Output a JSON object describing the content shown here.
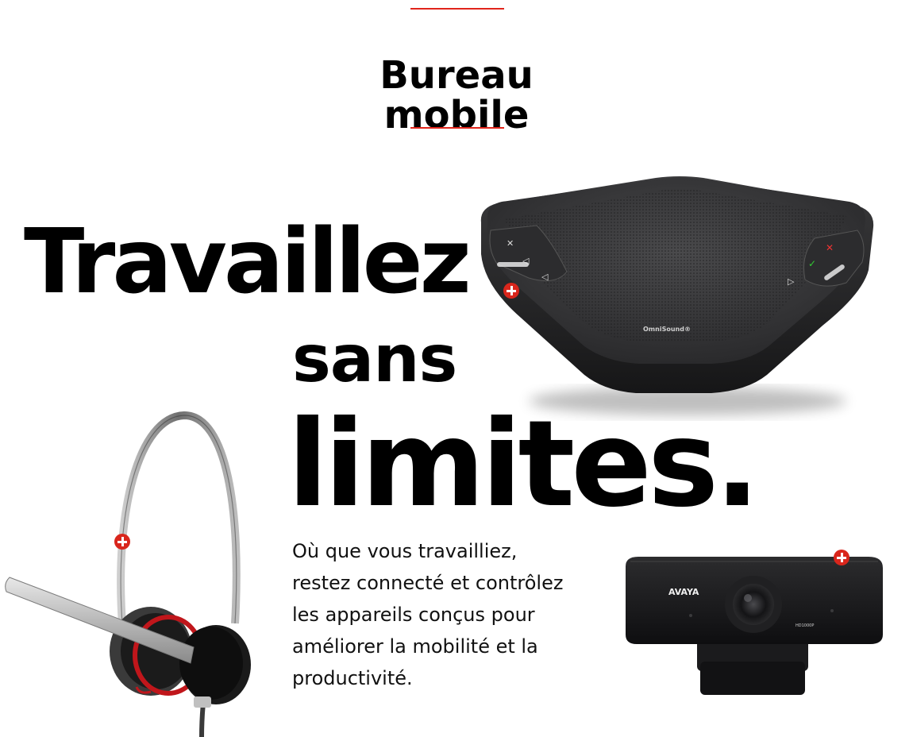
{
  "section": {
    "title_line1": "Bureau",
    "title_line2": "mobile"
  },
  "headline": {
    "line1": "Travaillez",
    "line2": "sans",
    "line3": "limites."
  },
  "body": {
    "line1": "Où que vous travailliez,",
    "line2": "restez connecté et contrôlez",
    "line3": "les appareils conçus pour",
    "line4": "améliorer la mobilité et la",
    "line5": "productivité."
  },
  "products": {
    "speaker_brand": "OmniSound®",
    "webcam_brand": "AVAYA",
    "webcam_model": "HD1000P"
  },
  "colors": {
    "accent": "#e1251b",
    "badge": "#d9261c",
    "text": "#000000"
  }
}
